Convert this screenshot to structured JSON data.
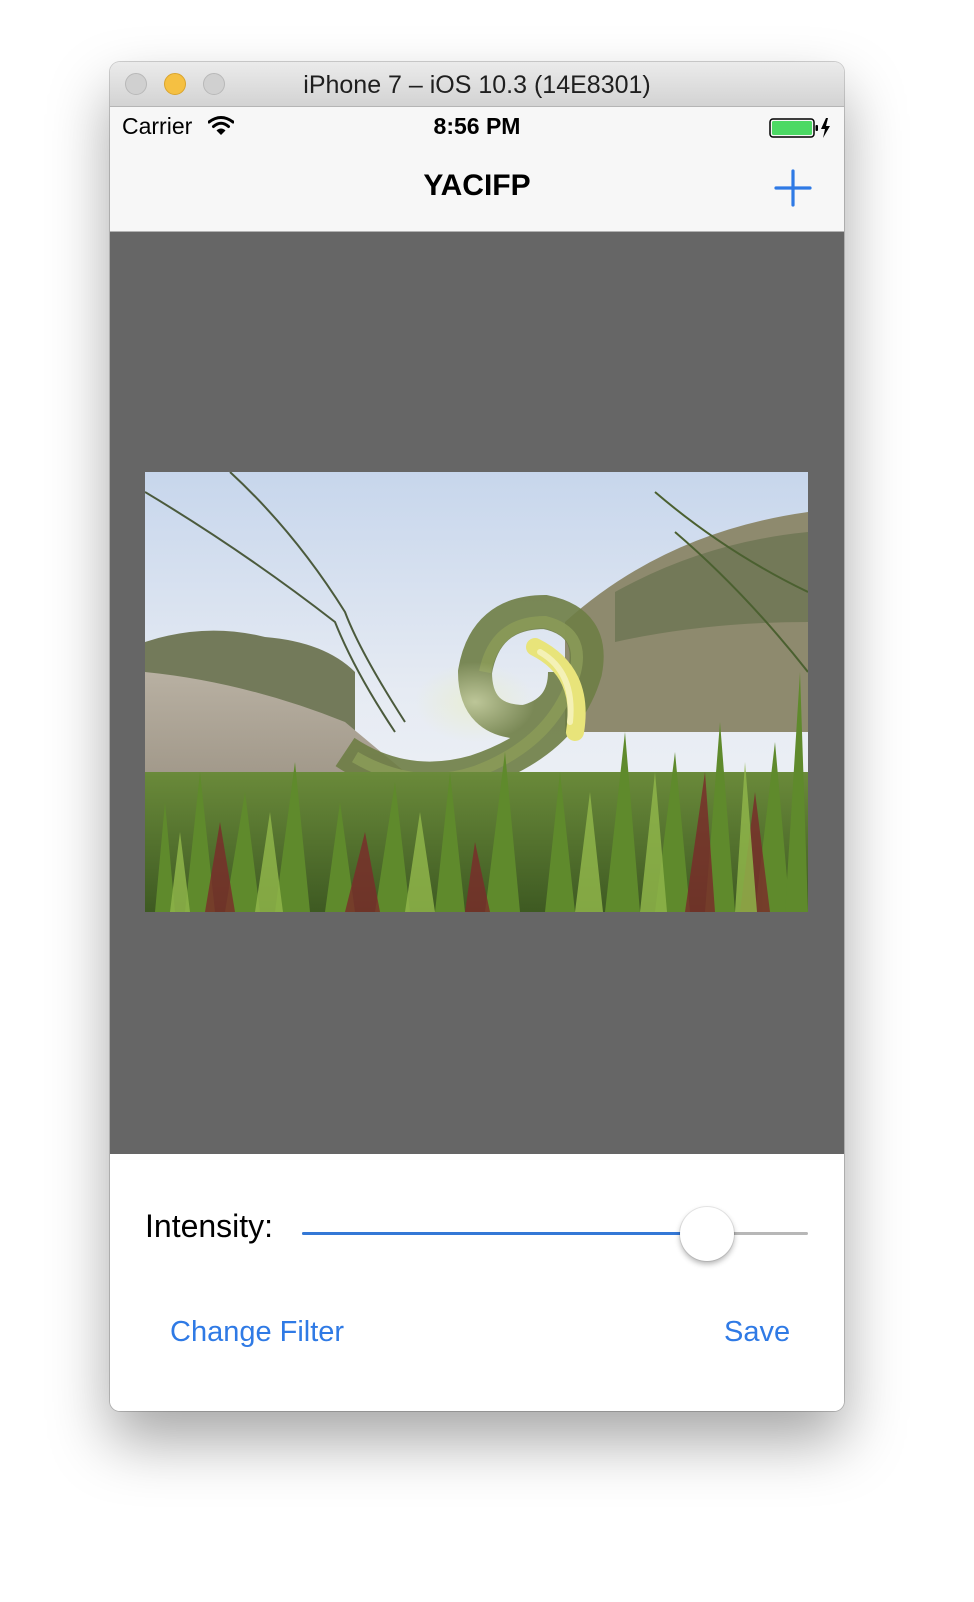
{
  "window": {
    "title": "iPhone 7 – iOS 10.3 (14E8301)"
  },
  "status_bar": {
    "carrier": "Carrier",
    "time": "8:56 PM"
  },
  "nav_bar": {
    "title": "YACIFP",
    "add_icon": "plus-icon"
  },
  "image": {
    "description_icon": "photo-image"
  },
  "controls": {
    "intensity_label": "Intensity:",
    "intensity_value": 0.8,
    "change_filter_label": "Change Filter",
    "save_label": "Save"
  },
  "colors": {
    "accent": "#2f7ae5",
    "canvas_background": "#666666",
    "battery": "#4cd964"
  }
}
